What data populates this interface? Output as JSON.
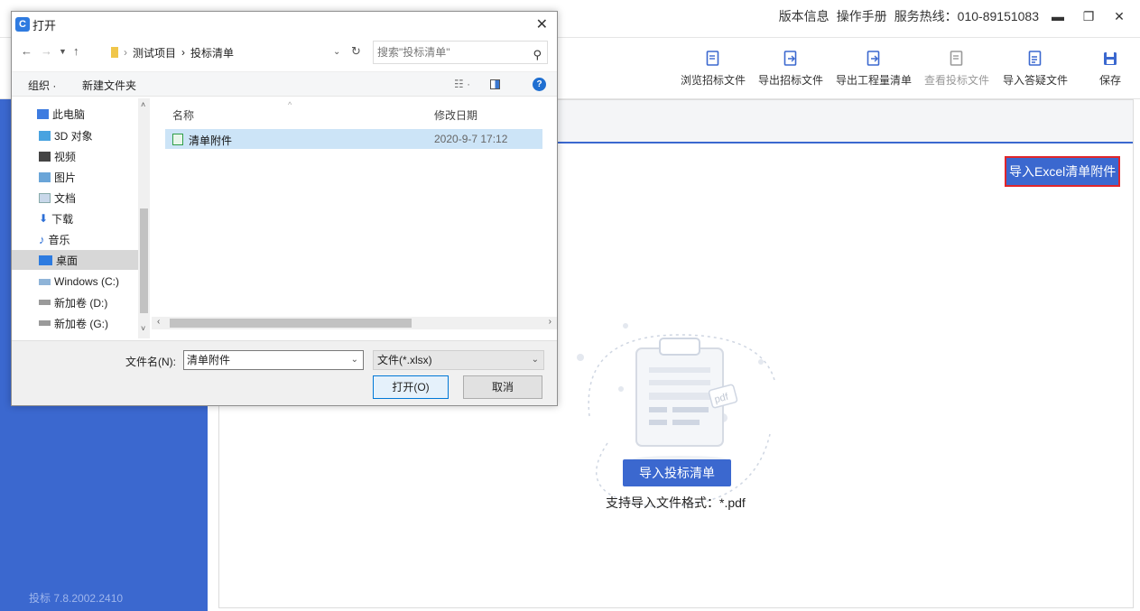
{
  "app": {
    "title_links": [
      "版本信息",
      "操作手册",
      "服务热线：010-89151083"
    ],
    "toolbar": [
      {
        "label": "浏览招标文件",
        "enabled": true
      },
      {
        "label": "导出招标文件",
        "enabled": true
      },
      {
        "label": "导出工程量清单",
        "enabled": true
      },
      {
        "label": "查看投标文件",
        "enabled": false
      },
      {
        "label": "导入答疑文件",
        "enabled": true
      },
      {
        "label": "保存",
        "enabled": true
      }
    ],
    "version": "投标   7.8.2002.2410",
    "excel_button": "导入Excel清单附件",
    "import_button": "导入投标清单",
    "support_text": "支持导入文件格式：*.pdf",
    "empty_state_icon": "pdf-file-clipboard-icon",
    "accent_color": "#3b68cf"
  },
  "dialog": {
    "title": "打开",
    "breadcrumb": [
      "测试项目",
      "投标清单"
    ],
    "search_placeholder": "搜索\"投标清单\"",
    "commands": {
      "organize": "组织 ·",
      "new_folder": "新建文件夹"
    },
    "nav_items": [
      {
        "label": "此电脑",
        "icon": "computer-icon"
      },
      {
        "label": "3D 对象",
        "icon": "3d-objects-icon"
      },
      {
        "label": "视频",
        "icon": "video-icon"
      },
      {
        "label": "图片",
        "icon": "pictures-icon"
      },
      {
        "label": "文档",
        "icon": "documents-icon"
      },
      {
        "label": "下载",
        "icon": "download-icon"
      },
      {
        "label": "音乐",
        "icon": "music-icon"
      },
      {
        "label": "桌面",
        "icon": "desktop-icon",
        "selected": true
      },
      {
        "label": "Windows (C:)",
        "icon": "drive-icon"
      },
      {
        "label": "新加卷 (D:)",
        "icon": "drive-icon"
      },
      {
        "label": "新加卷 (G:)",
        "icon": "drive-icon"
      }
    ],
    "columns": {
      "name": "名称",
      "modified": "修改日期"
    },
    "files": [
      {
        "name": "清单附件",
        "modified": "2020-9-7 17:12"
      }
    ],
    "filename_label": "文件名(N):",
    "filename_value": "清单附件",
    "filetype": "文件(*.xlsx)",
    "open_button": "打开(O)",
    "cancel_button": "取消"
  }
}
